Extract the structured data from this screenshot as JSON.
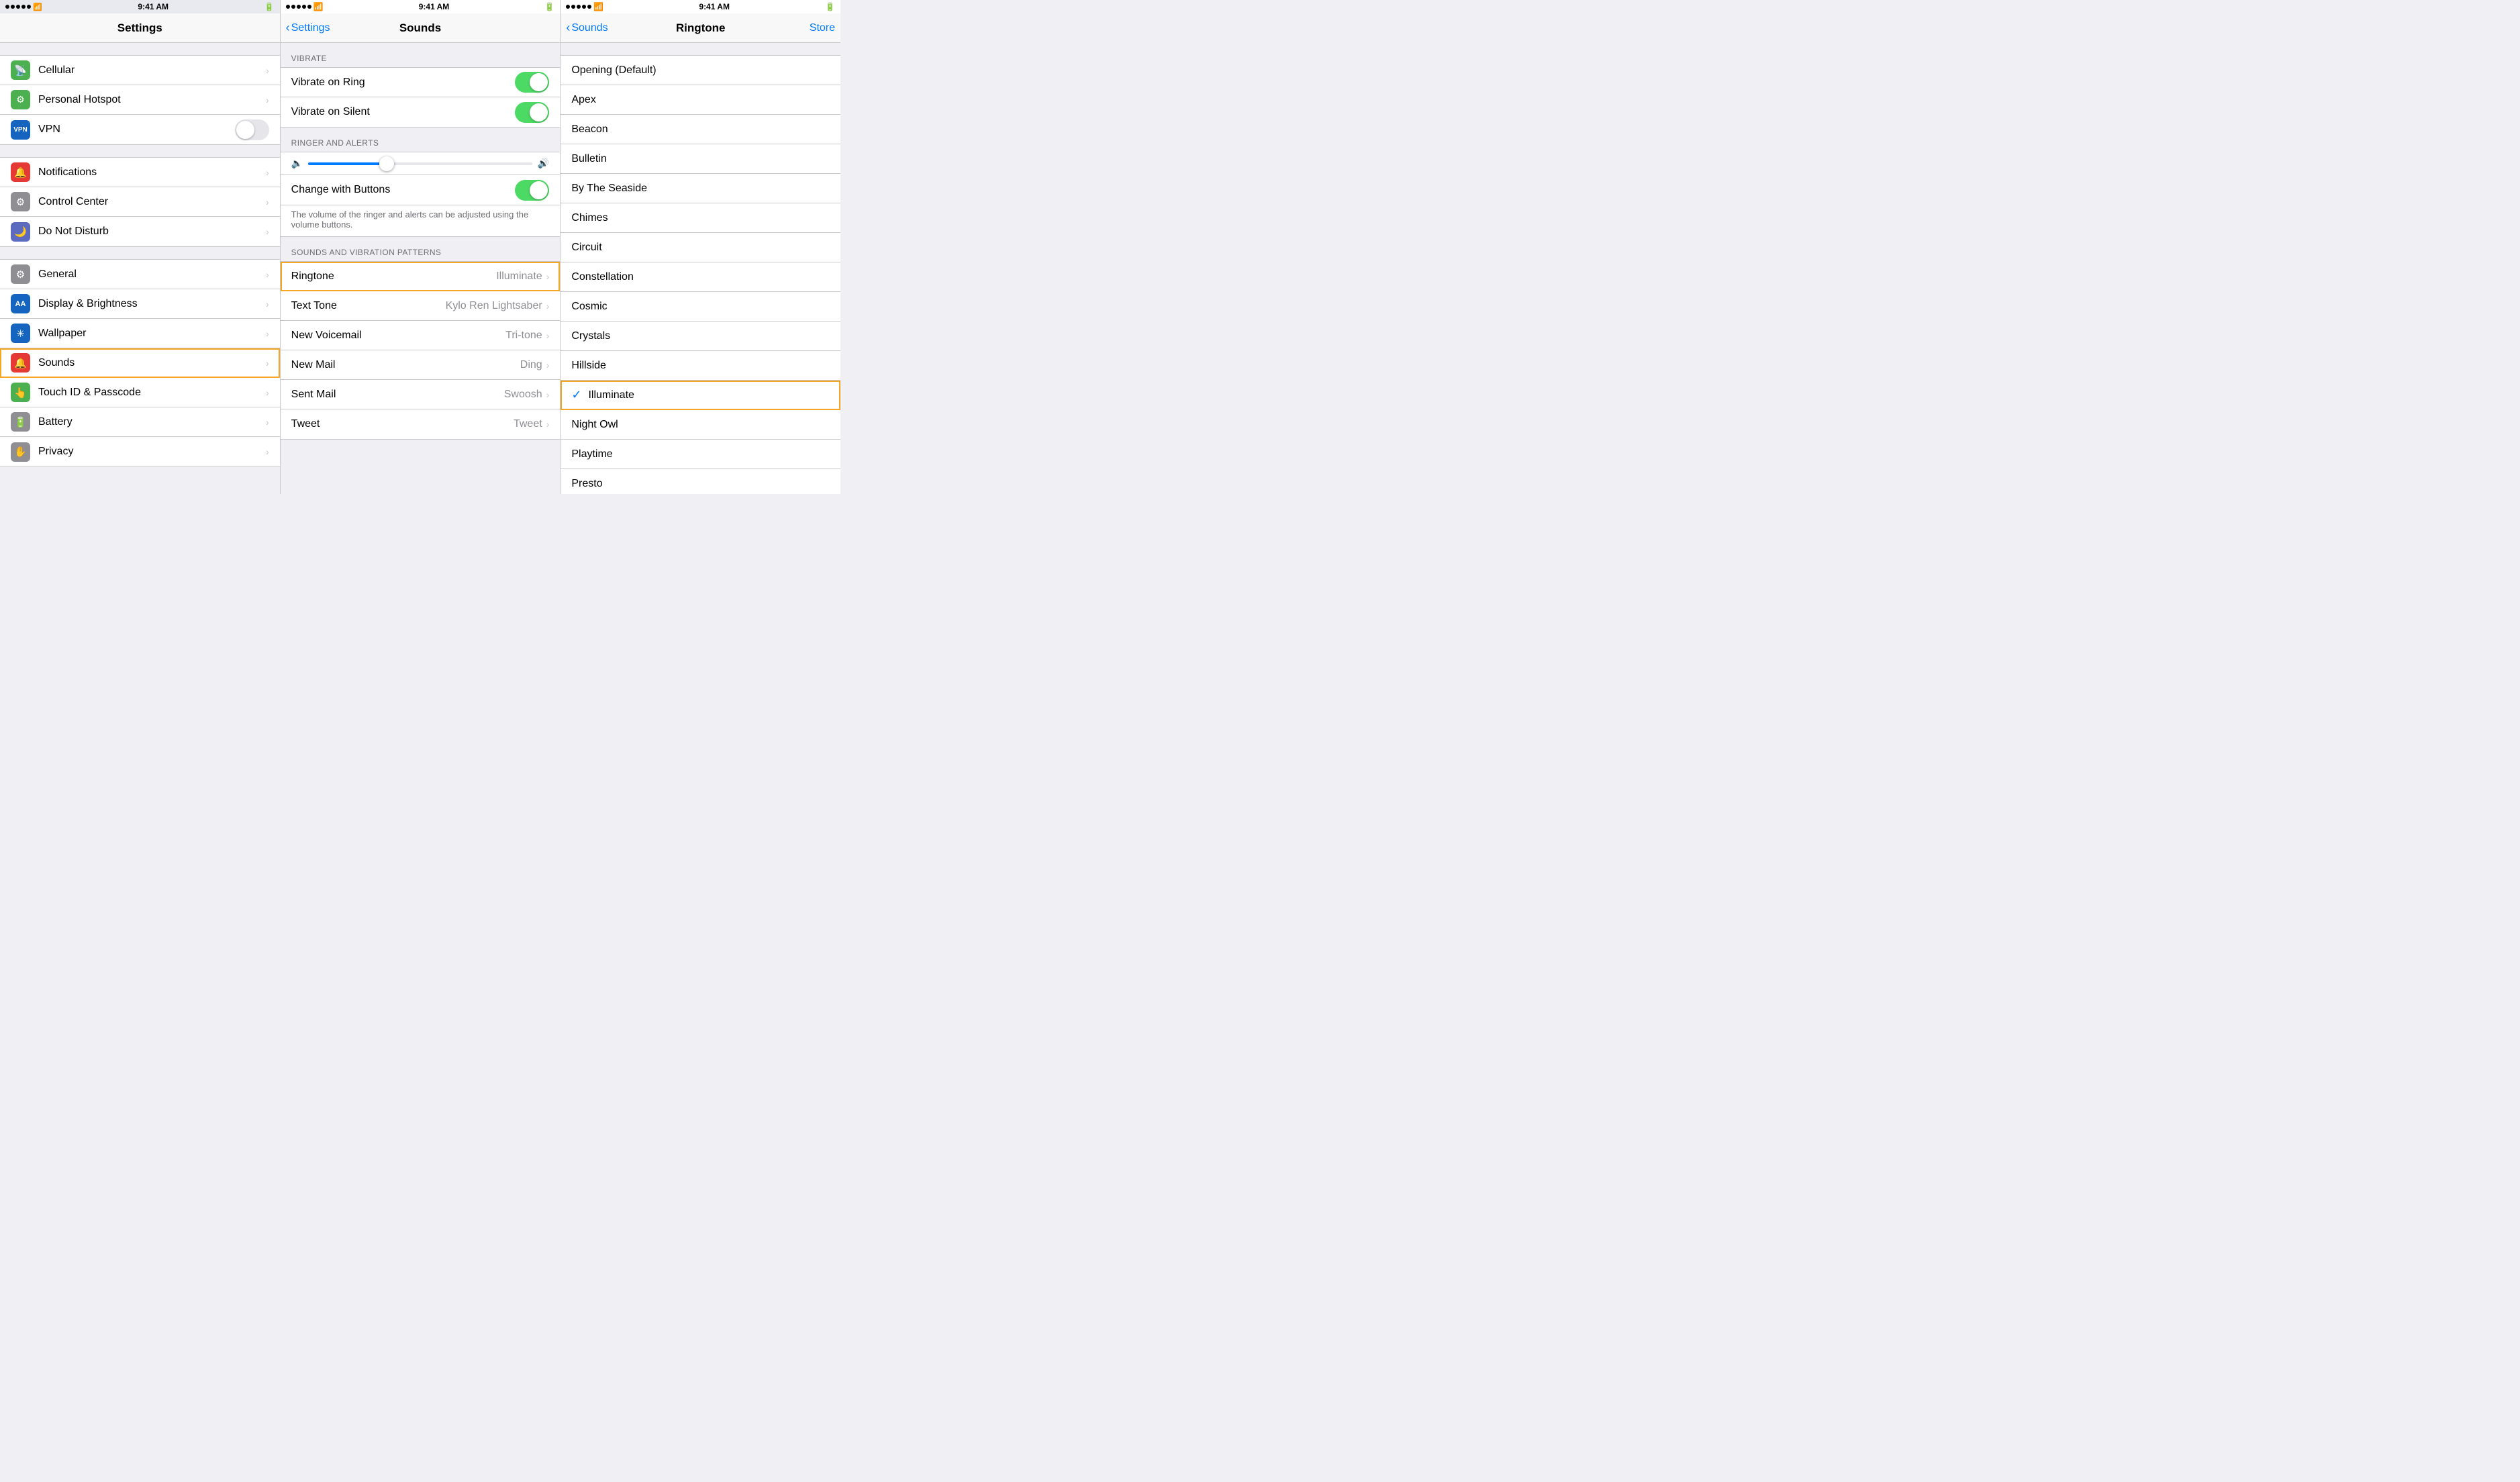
{
  "panel1": {
    "statusBar": {
      "time": "9:41 AM",
      "dots": 5,
      "wifi": true,
      "battery": true
    },
    "title": "Settings",
    "sections": [
      {
        "items": [
          {
            "id": "cellular",
            "label": "Cellular",
            "icon": "📡",
            "iconBg": "#4caf50",
            "hasChevron": true,
            "hasToggle": false
          },
          {
            "id": "hotspot",
            "label": "Personal Hotspot",
            "icon": "⚙",
            "iconBg": "#4caf50",
            "hasChevron": true,
            "hasToggle": false
          },
          {
            "id": "vpn",
            "label": "VPN",
            "icon": "VPN",
            "iconBg": "#1565c0",
            "hasChevron": false,
            "hasToggle": true,
            "toggleOn": false
          }
        ]
      },
      {
        "items": [
          {
            "id": "notifications",
            "label": "Notifications",
            "icon": "🔴",
            "iconBg": "#e53935",
            "hasChevron": true,
            "hasToggle": false
          },
          {
            "id": "control-center",
            "label": "Control Center",
            "icon": "⚙",
            "iconBg": "#8e8e93",
            "hasChevron": true,
            "hasToggle": false
          },
          {
            "id": "do-not-disturb",
            "label": "Do Not Disturb",
            "icon": "🌙",
            "iconBg": "#5c6bc0",
            "hasChevron": true,
            "hasToggle": false
          }
        ]
      },
      {
        "items": [
          {
            "id": "general",
            "label": "General",
            "icon": "⚙",
            "iconBg": "#8e8e93",
            "hasChevron": true,
            "hasToggle": false
          },
          {
            "id": "display",
            "label": "Display & Brightness",
            "icon": "AA",
            "iconBg": "#1565c0",
            "hasChevron": true,
            "hasToggle": false
          },
          {
            "id": "wallpaper",
            "label": "Wallpaper",
            "icon": "✳",
            "iconBg": "#1565c0",
            "hasChevron": true,
            "hasToggle": false
          },
          {
            "id": "sounds",
            "label": "Sounds",
            "icon": "🔔",
            "iconBg": "#e53935",
            "hasChevron": true,
            "hasToggle": false,
            "highlighted": true
          },
          {
            "id": "touchid",
            "label": "Touch ID & Passcode",
            "icon": "👆",
            "iconBg": "#4caf50",
            "hasChevron": true,
            "hasToggle": false
          },
          {
            "id": "battery",
            "label": "Battery",
            "icon": "🔋",
            "iconBg": "#8e8e93",
            "hasChevron": true,
            "hasToggle": false
          },
          {
            "id": "privacy",
            "label": "Privacy",
            "icon": "✋",
            "iconBg": "#8e8e93",
            "hasChevron": true,
            "hasToggle": false
          }
        ]
      }
    ]
  },
  "panel2": {
    "statusBar": {
      "time": "9:41 AM"
    },
    "backLabel": "Settings",
    "title": "Sounds",
    "sections": [
      {
        "header": "VIBRATE",
        "items": [
          {
            "id": "vibrate-ring",
            "label": "Vibrate on Ring",
            "toggleOn": true
          },
          {
            "id": "vibrate-silent",
            "label": "Vibrate on Silent",
            "toggleOn": true
          }
        ]
      },
      {
        "header": "RINGER AND ALERTS",
        "hasSlider": true,
        "items": [
          {
            "id": "change-buttons",
            "label": "Change with Buttons",
            "toggleOn": true
          }
        ],
        "description": "The volume of the ringer and alerts can be adjusted using the volume buttons."
      },
      {
        "header": "SOUNDS AND VIBRATION PATTERNS",
        "items": [
          {
            "id": "ringtone",
            "label": "Ringtone",
            "value": "Illuminate",
            "hasChevron": true,
            "highlighted": true
          },
          {
            "id": "text-tone",
            "label": "Text Tone",
            "value": "Kylo Ren Lightsaber",
            "hasChevron": true
          },
          {
            "id": "new-voicemail",
            "label": "New Voicemail",
            "value": "Tri-tone",
            "hasChevron": true
          },
          {
            "id": "new-mail",
            "label": "New Mail",
            "value": "Ding",
            "hasChevron": true
          },
          {
            "id": "sent-mail",
            "label": "Sent Mail",
            "value": "Swoosh",
            "hasChevron": true
          },
          {
            "id": "tweet",
            "label": "Tweet",
            "value": "Tweet",
            "hasChevron": true
          }
        ]
      }
    ]
  },
  "panel3": {
    "statusBar": {
      "time": "9:41 AM"
    },
    "backLabel": "Sounds",
    "title": "Ringtone",
    "actionLabel": "Store",
    "ringtones": [
      {
        "id": "opening",
        "label": "Opening (Default)",
        "selected": false
      },
      {
        "id": "apex",
        "label": "Apex",
        "selected": false
      },
      {
        "id": "beacon",
        "label": "Beacon",
        "selected": false
      },
      {
        "id": "bulletin",
        "label": "Bulletin",
        "selected": false
      },
      {
        "id": "by-the-seaside",
        "label": "By The Seaside",
        "selected": false
      },
      {
        "id": "chimes",
        "label": "Chimes",
        "selected": false
      },
      {
        "id": "circuit",
        "label": "Circuit",
        "selected": false
      },
      {
        "id": "constellation",
        "label": "Constellation",
        "selected": false
      },
      {
        "id": "cosmic",
        "label": "Cosmic",
        "selected": false
      },
      {
        "id": "crystals",
        "label": "Crystals",
        "selected": false
      },
      {
        "id": "hillside",
        "label": "Hillside",
        "selected": false
      },
      {
        "id": "illuminate",
        "label": "Illuminate",
        "selected": true,
        "highlighted": true
      },
      {
        "id": "night-owl",
        "label": "Night Owl",
        "selected": false
      },
      {
        "id": "playtime",
        "label": "Playtime",
        "selected": false
      },
      {
        "id": "presto",
        "label": "Presto",
        "selected": false
      }
    ]
  }
}
